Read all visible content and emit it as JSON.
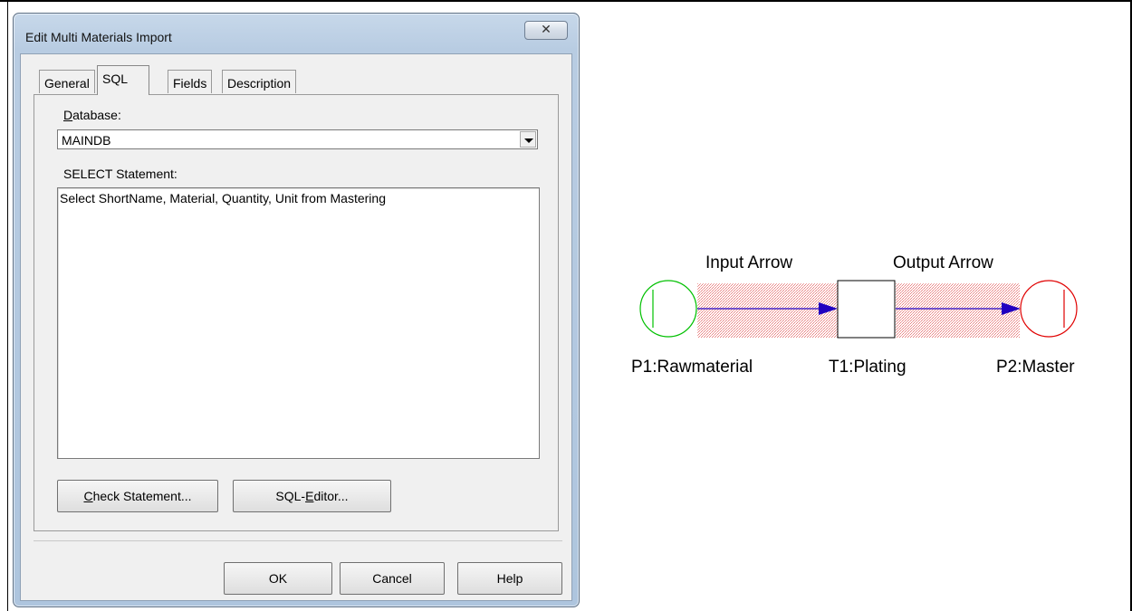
{
  "dialog": {
    "title": "Edit Multi Materials Import",
    "close_glyph": "✕",
    "tabs": [
      {
        "label": "General",
        "active": false
      },
      {
        "label": "SQL",
        "active": true
      },
      {
        "label": "Fields",
        "active": false
      },
      {
        "label": "Description",
        "active": false
      }
    ],
    "database": {
      "label_u": "D",
      "label_rest": "atabase:",
      "value": "MAINDB"
    },
    "select_statement": {
      "label": "SELECT Statement:",
      "value": "Select ShortName, Material, Quantity, Unit from Mastering"
    },
    "buttons": {
      "check_u": "C",
      "check_rest": "heck Statement...",
      "sqleditor_pre": "SQL-",
      "sqleditor_u": "E",
      "sqleditor_rest": "ditor...",
      "ok": "OK",
      "cancel": "Cancel",
      "help": "Help"
    }
  },
  "diagram": {
    "input_arrow_label": "Input Arrow",
    "output_arrow_label": "Output Arrow",
    "place1_label": "P1:Rawmaterial",
    "transition_label": "T1:Plating",
    "place2_label": "P2:Master",
    "colors": {
      "place1": "#00c000",
      "place2": "#e00000",
      "arrow": "#2000c0",
      "highlight": "#f08080"
    }
  }
}
